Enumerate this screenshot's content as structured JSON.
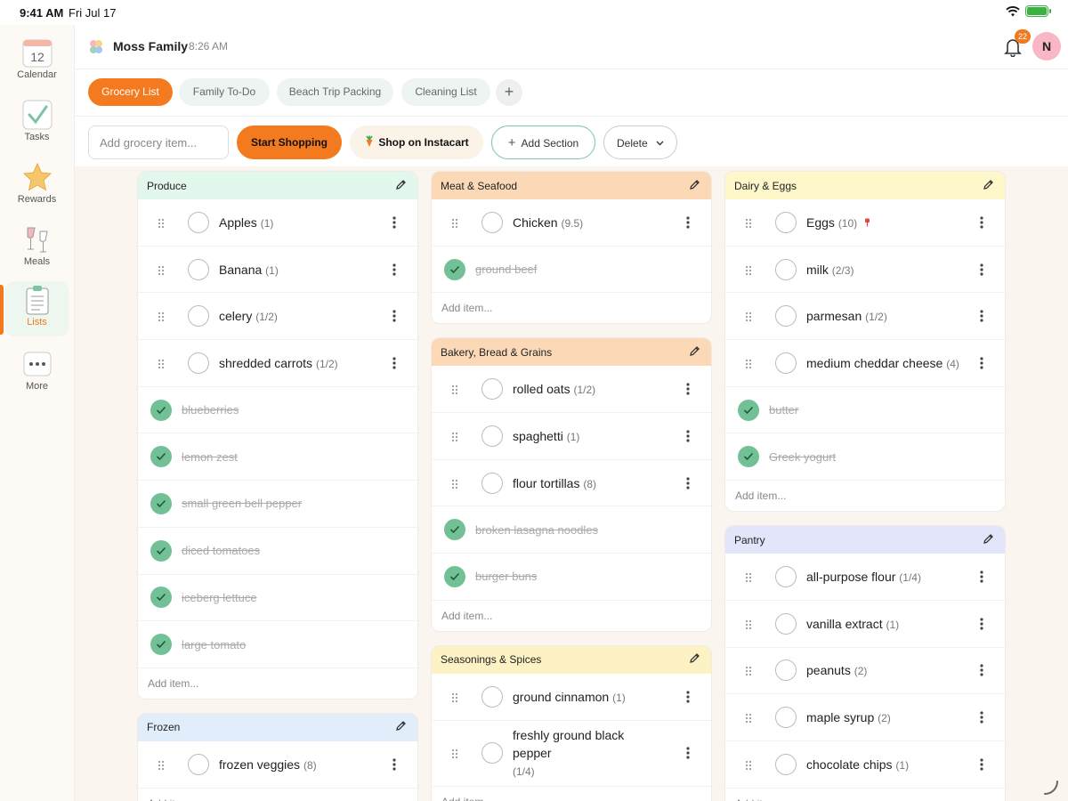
{
  "status": {
    "time": "9:41 AM",
    "date": "Fri Jul 17"
  },
  "sidebar": {
    "items": [
      {
        "label": "Calendar",
        "icon": "calendar-icon",
        "day": "12"
      },
      {
        "label": "Tasks",
        "icon": "checkmark-icon"
      },
      {
        "label": "Rewards",
        "icon": "star-icon"
      },
      {
        "label": "Meals",
        "icon": "wine-glasses-icon"
      },
      {
        "label": "Lists",
        "icon": "clipboard-icon",
        "active": true
      },
      {
        "label": "More",
        "icon": "ellipsis-icon"
      }
    ]
  },
  "header": {
    "family": "Moss Family",
    "time": "8:26 AM",
    "notifications": "22",
    "avatar_initial": "N"
  },
  "tabs": [
    {
      "label": "Grocery List",
      "active": true
    },
    {
      "label": "Family To-Do"
    },
    {
      "label": "Beach Trip Packing"
    },
    {
      "label": "Cleaning List"
    }
  ],
  "toolbar": {
    "input_placeholder": "Add grocery item...",
    "start_shopping": "Start Shopping",
    "instacart": "Shop on Instacart",
    "add_section": "Add Section",
    "delete": "Delete"
  },
  "add_item_label": "Add item...",
  "columns": [
    [
      {
        "title": "Produce",
        "color": "#e2f8ec",
        "items": [
          {
            "name": "Apples",
            "qty": "(1)"
          },
          {
            "name": "Banana",
            "qty": "(1)"
          },
          {
            "name": "celery",
            "qty": "(1/2)"
          },
          {
            "name": "shredded carrots",
            "qty": "(1/2)"
          }
        ],
        "done": [
          "blueberries",
          "lemon zest",
          "small green bell pepper",
          "diced tomatoes",
          "iceberg lettuce",
          "large tomato"
        ]
      },
      {
        "title": "Frozen",
        "color": "#e1edfb",
        "items": [
          {
            "name": "frozen veggies",
            "qty": "(8)"
          }
        ],
        "done": []
      }
    ],
    [
      {
        "title": "Meat & Seafood",
        "color": "#fcd9b6",
        "items": [
          {
            "name": "Chicken",
            "qty": "(9.5)"
          }
        ],
        "done": [
          "ground beef"
        ]
      },
      {
        "title": "Bakery, Bread & Grains",
        "color": "#fcd9b6",
        "items": [
          {
            "name": "rolled oats",
            "qty": "(1/2)"
          },
          {
            "name": "spaghetti",
            "qty": "(1)"
          },
          {
            "name": "flour tortillas",
            "qty": "(8)"
          }
        ],
        "done": [
          "broken lasagna noodles",
          "burger buns"
        ]
      },
      {
        "title": "Seasonings & Spices",
        "color": "#fdf2c4",
        "items": [
          {
            "name": "ground cinnamon",
            "qty": "(1)"
          },
          {
            "name": "freshly ground black pepper",
            "qty": "(1/4)",
            "tall": true
          }
        ],
        "done": []
      }
    ],
    [
      {
        "title": "Dairy & Eggs",
        "color": "#fdf7c9",
        "items": [
          {
            "name": "Eggs",
            "qty": "(10)",
            "pinned": true
          },
          {
            "name": "milk",
            "qty": "(2/3)"
          },
          {
            "name": "parmesan",
            "qty": "(1/2)"
          },
          {
            "name": "medium cheddar cheese",
            "qty": "(4)"
          }
        ],
        "done": [
          "butter",
          "Greek yogurt"
        ]
      },
      {
        "title": "Pantry",
        "color": "#e3e6fb",
        "items": [
          {
            "name": "all-purpose flour",
            "qty": "(1/4)"
          },
          {
            "name": "vanilla extract",
            "qty": "(1)"
          },
          {
            "name": "peanuts",
            "qty": "(2)"
          },
          {
            "name": "maple syrup",
            "qty": "(2)"
          },
          {
            "name": "chocolate chips",
            "qty": "(1)"
          }
        ],
        "done": []
      }
    ]
  ]
}
